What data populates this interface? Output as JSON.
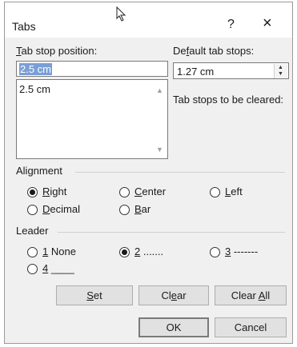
{
  "dialog": {
    "title": "Tabs",
    "help_label": "?",
    "close_label": "×"
  },
  "tab_stop": {
    "label_underlined": "T",
    "label_rest": "ab stop position:",
    "value": "2.5 cm",
    "list_items": [
      "2.5 cm"
    ]
  },
  "default_tabs": {
    "label_pre": "De",
    "label_underlined": "f",
    "label_post": "ault tab stops:",
    "value": "1.27 cm"
  },
  "cleared_label": "Tab stops to be cleared:",
  "alignment": {
    "heading": "Alignment",
    "options": [
      {
        "u": "R",
        "rest": "ight",
        "checked": true
      },
      {
        "u": "C",
        "rest": "enter",
        "checked": false
      },
      {
        "u": "L",
        "rest": "eft",
        "checked": false
      },
      {
        "u": "D",
        "rest": "ecimal",
        "checked": false
      },
      {
        "u": "B",
        "rest": "ar",
        "checked": false
      }
    ]
  },
  "leader": {
    "heading": "Leader",
    "options": [
      {
        "u": "1",
        "rest": " None",
        "checked": false
      },
      {
        "u": "2",
        "rest": " .......",
        "checked": true
      },
      {
        "u": "3",
        "rest": " -------",
        "checked": false
      },
      {
        "u": "4",
        "rest": " ____",
        "checked": false
      }
    ]
  },
  "buttons": {
    "set": {
      "u": "S",
      "rest": "et"
    },
    "clear": {
      "pre": "Cl",
      "u": "e",
      "rest": "ar"
    },
    "clear_all": {
      "pre": "Clear ",
      "u": "A",
      "rest": "ll"
    },
    "ok": "OK",
    "cancel": "Cancel"
  }
}
